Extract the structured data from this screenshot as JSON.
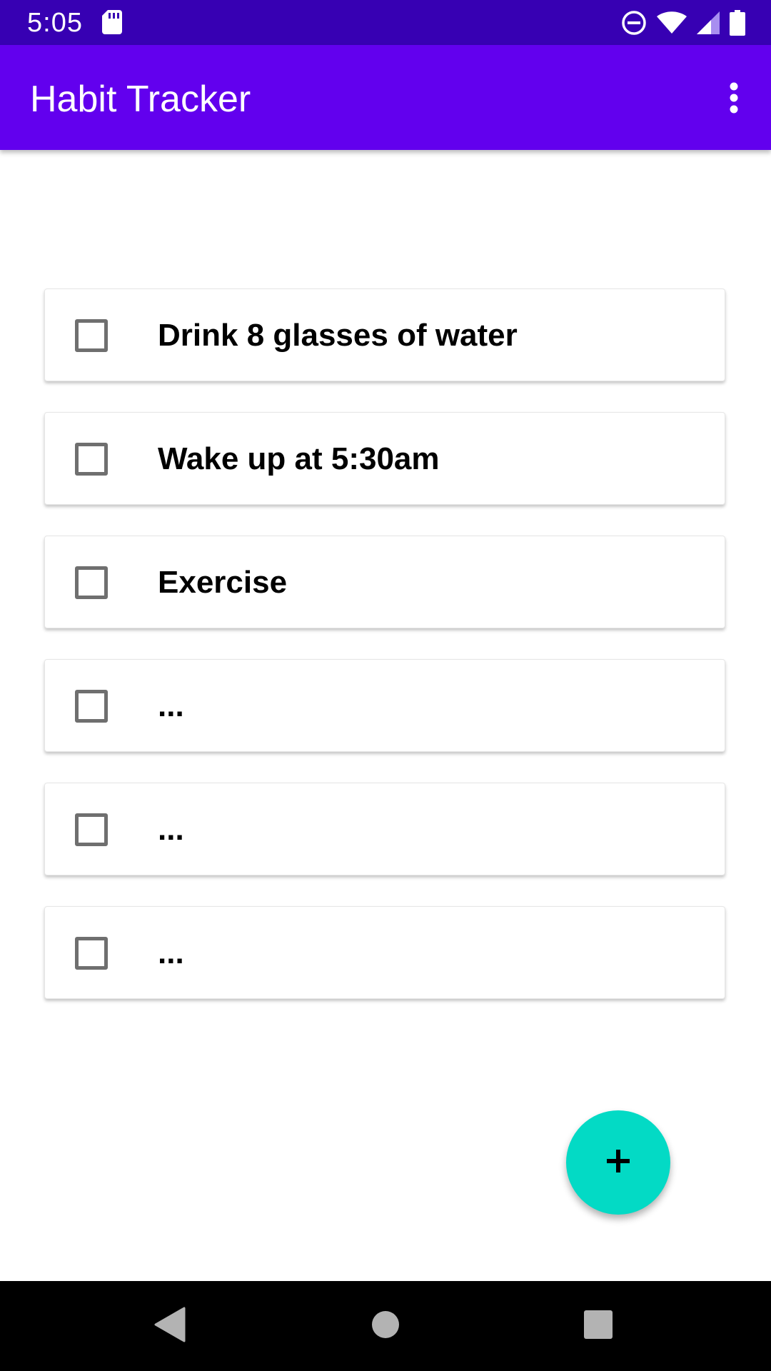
{
  "status_bar": {
    "time": "5:05",
    "icons": [
      "sd-card-icon",
      "do-not-disturb-icon",
      "wifi-icon",
      "cellular-signal-icon",
      "battery-icon"
    ]
  },
  "app_bar": {
    "title": "Habit Tracker",
    "overflow_icon": "more-vert-icon"
  },
  "habits": [
    {
      "label": "Drink 8 glasses of water",
      "checked": false
    },
    {
      "label": "Wake up at 5:30am",
      "checked": false
    },
    {
      "label": "Exercise",
      "checked": false
    },
    {
      "label": "...",
      "checked": false
    },
    {
      "label": "...",
      "checked": false
    },
    {
      "label": "...",
      "checked": false
    }
  ],
  "fab": {
    "icon": "plus-icon"
  },
  "nav_bar": {
    "icons": [
      "back-icon",
      "home-icon",
      "recents-icon"
    ]
  },
  "colors": {
    "status_bar": "#3700b3",
    "app_bar": "#6200ee",
    "fab": "#03dac5",
    "checkbox_border": "#6f6f6f",
    "nav_bar": "#000000"
  }
}
